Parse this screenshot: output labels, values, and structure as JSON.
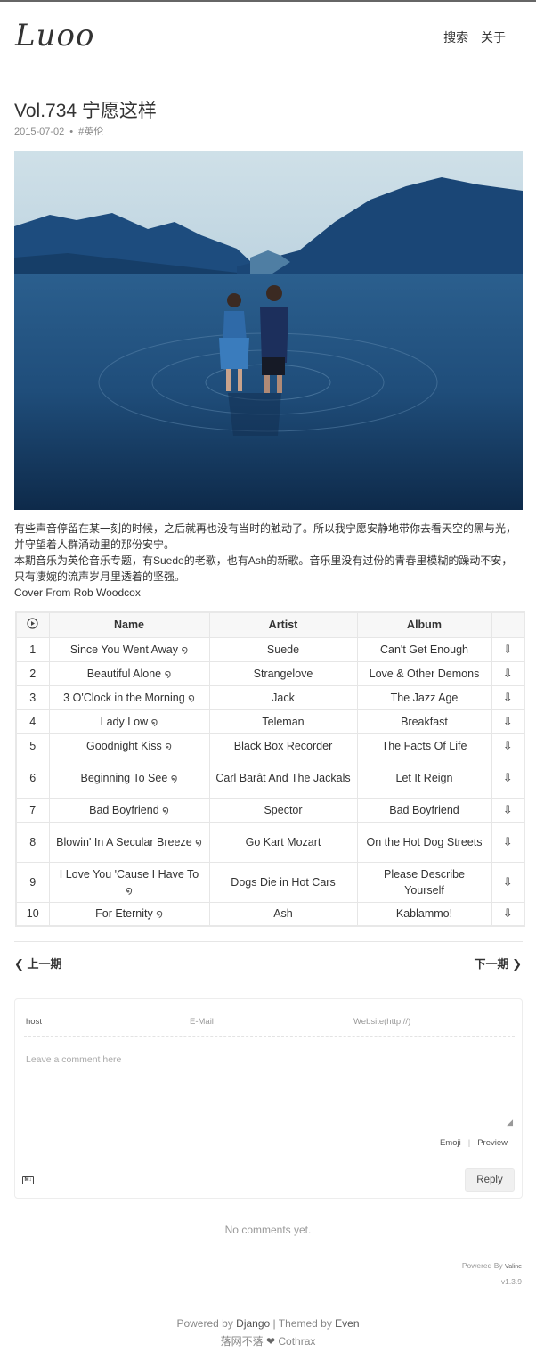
{
  "header": {
    "logo": "Luoo",
    "nav": [
      "搜索",
      "关于"
    ]
  },
  "post": {
    "title": "Vol.734 宁愿这样",
    "date": "2015-07-02",
    "tag": "#英伦",
    "description": [
      "有些声音停留在某一刻的时候，之后就再也没有当时的触动了。所以我宁愿安静地带你去看天空的黑与光，",
      "并守望着人群涌动里的那份安宁。",
      "本期音乐为英伦音乐专题，有Suede的老歌，也有Ash的新歌。音乐里没有过份的青春里模糊的躁动不安，",
      "只有凄婉的流声岁月里透着的坚强。",
      "Cover From Rob Woodcox"
    ]
  },
  "tracks": {
    "headers": [
      "Name",
      "Artist",
      "Album"
    ],
    "rows": [
      {
        "num": "1",
        "name": "Since You Went Away",
        "artist": "Suede",
        "album": "Can't Get Enough"
      },
      {
        "num": "2",
        "name": "Beautiful Alone",
        "artist": "Strangelove",
        "album": "Love & Other Demons"
      },
      {
        "num": "3",
        "name": "3 O'Clock in the Morning",
        "artist": "Jack",
        "album": "The Jazz Age"
      },
      {
        "num": "4",
        "name": "Lady Low",
        "artist": "Teleman",
        "album": "Breakfast"
      },
      {
        "num": "5",
        "name": "Goodnight Kiss",
        "artist": "Black Box Recorder",
        "album": "The Facts Of Life"
      },
      {
        "num": "6",
        "name": "Beginning To See",
        "artist": "Carl Barât And The Jackals",
        "album": "Let It Reign"
      },
      {
        "num": "7",
        "name": "Bad Boyfriend",
        "artist": "Spector",
        "album": "Bad Boyfriend"
      },
      {
        "num": "8",
        "name": "Blowin' In A Secular Breeze",
        "artist": "Go Kart Mozart",
        "album": "On the Hot Dog Streets"
      },
      {
        "num": "9",
        "name": "I Love You 'Cause I Have To",
        "artist": "Dogs Die in Hot Cars",
        "album": "Please Describe Yourself"
      },
      {
        "num": "10",
        "name": "For Eternity",
        "artist": "Ash",
        "album": "Kablammo!"
      }
    ]
  },
  "pager": {
    "prev": "上一期",
    "next": "下一期"
  },
  "comments": {
    "nick_value": "host",
    "mail_placeholder": "E-Mail",
    "website_placeholder": "Website(http://)",
    "textarea_placeholder": "Leave a comment here",
    "emoji": "Emoji",
    "separator": "|",
    "preview": "Preview",
    "reply": "Reply",
    "markdown_badge": "M↓",
    "empty": "No comments yet.",
    "powered": "Powered By",
    "powered_brand": "Valine",
    "version": "v1.3.9"
  },
  "footer": {
    "powered_prefix": "Powered by",
    "powered_link": "Django",
    "sep": "|",
    "themed_prefix": "Themed by",
    "themed_link": "Even",
    "site": "落网不落",
    "heart": "❤",
    "author": "Cothrax"
  }
}
